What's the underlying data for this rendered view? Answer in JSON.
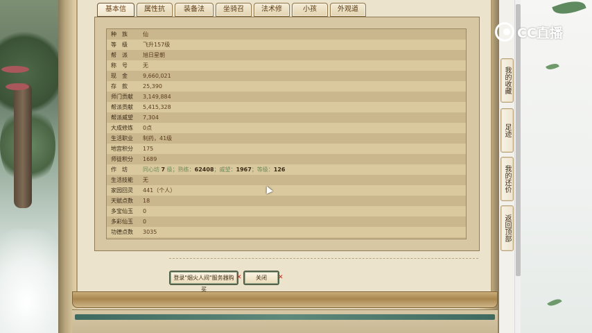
{
  "logo": {
    "text": "CC直播"
  },
  "tabs": [
    {
      "label": "基本信息",
      "active": true
    },
    {
      "label": "属性抗性"
    },
    {
      "label": "装备法宝"
    },
    {
      "label": "坐骑召唤兽"
    },
    {
      "label": "法术修正"
    },
    {
      "label": "小孩"
    },
    {
      "label": "外观道具"
    }
  ],
  "info": [
    {
      "key": "种　族",
      "value": "仙"
    },
    {
      "key": "等　级",
      "value": "飞升157级"
    },
    {
      "key": "帮　派",
      "value": "旭日星朝"
    },
    {
      "key": "称　号",
      "value": "无"
    },
    {
      "key": "现　金",
      "value": "9,660,021"
    },
    {
      "key": "存　款",
      "value": "25,390"
    },
    {
      "key": "师门贡献",
      "value": "3,149,884"
    },
    {
      "key": "帮派贡献",
      "value": "5,415,328"
    },
    {
      "key": "帮派威望",
      "value": "7,304"
    },
    {
      "key": "大成修炼",
      "value": "0点"
    },
    {
      "key": "生活职业",
      "value": "制药，41级"
    },
    {
      "key": "地宫积分",
      "value": "175"
    },
    {
      "key": "师徒积分",
      "value": "1689"
    },
    {
      "key": "作　坊",
      "value": {
        "prefix": "同心坊",
        "level": "7",
        "level_unit": "级；",
        "exp_label": "熟练：",
        "exp": "62408",
        "fame_label": "；威望：",
        "fame": "1967",
        "grade_label": "；等级：",
        "grade": "126"
      }
    },
    {
      "key": "生活技能",
      "value": "无"
    },
    {
      "key": "家园回灵",
      "value": "441（个人）"
    },
    {
      "key": "天赋点数",
      "value": "18"
    },
    {
      "key": "多宝仙玉",
      "value": "0"
    },
    {
      "key": "多彩仙玉",
      "value": "0"
    },
    {
      "key": "功德点数",
      "value": "3035"
    }
  ],
  "buttons": {
    "login": "登录\"烟火人间\"服务器购买",
    "close": "关闭"
  },
  "side_nav": [
    "我的收藏",
    "足迹",
    "我的还价",
    "返回顶部"
  ],
  "colors": {
    "panel_bg": "#d7c7a2",
    "row_odd": "#cbb78e",
    "row_even": "#dac99f",
    "value_green": "#4f8a4b",
    "value_yellow": "#e5c230",
    "button_border": "#55624b",
    "close_mark": "#c2271b"
  }
}
